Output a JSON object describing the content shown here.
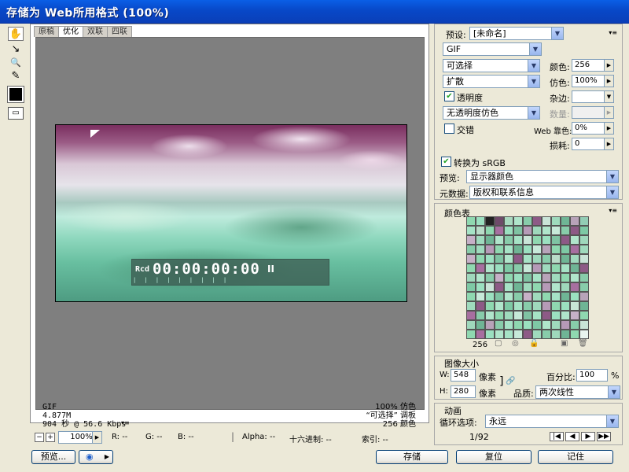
{
  "window": {
    "title": "存储为 Web所用格式 (100%)"
  },
  "tools": [
    {
      "name": "hand-tool-icon",
      "glyph": "✋"
    },
    {
      "name": "slice-select-tool-icon",
      "glyph": "↘"
    },
    {
      "name": "zoom-tool-icon",
      "glyph": "🔍"
    },
    {
      "name": "eyedropper-tool-icon",
      "glyph": "✎"
    }
  ],
  "tabs": [
    "原稿",
    "优化",
    "双联",
    "四联"
  ],
  "active_tab": "优化",
  "preview": {
    "timecode_prefix": "Rcd",
    "timecode": "00:00:00:00",
    "pause_glyph": "II"
  },
  "image_info": {
    "format": "GIF",
    "size": "4.877M",
    "time": "904 秒 @ 56.6 Kbps",
    "dither": "100% 仿色",
    "palette": "“可选择” 调板",
    "colors_count": "256 颜色"
  },
  "settings": {
    "preset_label": "预设:",
    "preset_value": "[未命名]",
    "format": "GIF",
    "palette_mode": "可选择",
    "dither_algo": "扩散",
    "transparency_label": "透明度",
    "transparency_checked": true,
    "transparency_dither": "无透明度仿色",
    "interlace_label": "交错",
    "interlace_checked": false,
    "colors_label": "颜色:",
    "colors_value": "256",
    "dither_label": "仿色:",
    "dither_value": "100%",
    "matte_label": "杂边:",
    "matte_value": "",
    "amount_label": "数量:",
    "amount_value": "",
    "web_snap_label": "Web 靠色:",
    "web_snap_value": "0%",
    "lossy_label": "损耗:",
    "lossy_value": "0",
    "convert_srgb_label": "转换为 sRGB",
    "convert_srgb_checked": true,
    "preview_label": "预览:",
    "preview_value": "显示器颜色",
    "metadata_label": "元数据:",
    "metadata_value": "版权和联系信息"
  },
  "color_table": {
    "title": "颜色表",
    "count": "256",
    "colors": [
      "#8FD8B0",
      "#9BE0C0",
      "#222222",
      "#6F4A6A",
      "#A9D9C0",
      "#B0E5CB",
      "#88CCAA",
      "#8D5A86",
      "#C9E4D7",
      "#9FDABD",
      "#6FB595",
      "#B8A3B9",
      "#93CDB5",
      "#A6E3C6",
      "#B9DCC8",
      "#8FD8B0",
      "#A76FA0",
      "#9BE0C0",
      "#7FC3A3",
      "#B69AB7",
      "#9FD8BC",
      "#B0E5CB",
      "#C7E9D9",
      "#88CCAA",
      "#8D5A86",
      "#7EC9A5",
      "#C6B0C7",
      "#9FDABD",
      "#6FB595",
      "#B0E5CB",
      "#88CCAA",
      "#A6E3C6",
      "#C9E4D7",
      "#8FD8B0",
      "#9BE0C0",
      "#7FC3A3",
      "#8D5A86",
      "#B0E5CB",
      "#9FD8BC",
      "#88CCAA",
      "#9FDABD",
      "#B69AB7",
      "#8FD8B0",
      "#A6E3C6",
      "#6FB595",
      "#9BE0C0",
      "#C7E9D9",
      "#B8A3B9",
      "#8FD8B0",
      "#7EC9A5",
      "#A76FA0",
      "#9FDABD",
      "#C6B0C7",
      "#8FD8B0",
      "#9BE0C0",
      "#7FC3A3",
      "#B0E5CB",
      "#8D5A86",
      "#A6E3C6",
      "#9FD8BC",
      "#88CCAA",
      "#B9DCC8",
      "#6FB595",
      "#9FDABD",
      "#C9E4D7",
      "#8FD8B0",
      "#A76FA0",
      "#B0E5CB",
      "#9BE0C0",
      "#7EC9A5",
      "#88CCAA",
      "#C7E9D9",
      "#B69AB7",
      "#9FDABD",
      "#8FD8B0",
      "#A6E3C6",
      "#6FB595",
      "#8D5A86",
      "#9FD8BC",
      "#B0E5CB",
      "#88CCAA",
      "#C6B0C7",
      "#8FD8B0",
      "#9BE0C0",
      "#7FC3A3",
      "#A6E3C6",
      "#B8A3B9",
      "#9FDABD",
      "#8FD8B0",
      "#B0E5CB",
      "#88CCAA",
      "#7EC9A5",
      "#9BE0C0",
      "#C9E4D7",
      "#8D5A86",
      "#A6E3C6",
      "#6FB595",
      "#9FDABD",
      "#8FD8B0",
      "#B69AB7",
      "#B0E5CB",
      "#9FD8BC",
      "#A76FA0",
      "#88CCAA",
      "#8FD8B0",
      "#C7E9D9",
      "#9BE0C0",
      "#7FC3A3",
      "#B0E5CB",
      "#88CCAA",
      "#C6B0C7",
      "#9FDABD",
      "#8FD8B0",
      "#A6E3C6",
      "#6FB595",
      "#9BE0C0",
      "#B8A3B9",
      "#9FDABD",
      "#8D5A86",
      "#8FD8B0",
      "#B0E5CB",
      "#7EC9A5",
      "#A6E3C6",
      "#88CCAA",
      "#9FD8BC",
      "#B69AB7",
      "#8FD8B0",
      "#9BE0C0",
      "#C9E4D7",
      "#6FB595",
      "#A76FA0",
      "#88CCAA",
      "#B0E5CB",
      "#8FD8B0",
      "#9FDABD",
      "#C7E9D9",
      "#7FC3A3",
      "#A6E3C6",
      "#8D5A86",
      "#9BE0C0",
      "#B0E5CB",
      "#C6B0C7",
      "#8FD8B0",
      "#9FD8BC",
      "#6FB595",
      "#B8A3B9",
      "#88CCAA",
      "#A6E3C6",
      "#8FD8B0",
      "#9BE0C0",
      "#7EC9A5",
      "#B0E5CB",
      "#9FDABD",
      "#B69AB7",
      "#88CCAA",
      "#C9E4D7",
      "#8FD8B0",
      "#A76FA0",
      "#9BE0C0",
      "#B0E5CB",
      "#A6E3C6",
      "#C7E9D9",
      "#8D5A86",
      "#9FDABD",
      "#88CCAA",
      "#9FD8BC",
      "#6FB595",
      "#8FD8B0",
      "#E8F4EE"
    ]
  },
  "image_size": {
    "title": "图像大小",
    "w_label": "W:",
    "w_value": "548",
    "w_unit": "像素",
    "h_label": "H:",
    "h_value": "280",
    "h_unit": "像素",
    "percent_label": "百分比:",
    "percent_value": "100",
    "percent_unit": "%",
    "quality_label": "品质:",
    "quality_value": "两次线性"
  },
  "animation": {
    "title": "动画",
    "loop_label": "循环选项:",
    "loop_value": "永远",
    "frame_counter": "1/92"
  },
  "status_bar": {
    "zoom": "100%",
    "r": "R: --",
    "g": "G: --",
    "b": "B: --",
    "alpha": "Alpha: --",
    "hex": "十六进制: --",
    "index": "索引: --"
  },
  "buttons": {
    "preview": "预览...",
    "save": "存储",
    "reset": "复位",
    "remember": "记住"
  }
}
